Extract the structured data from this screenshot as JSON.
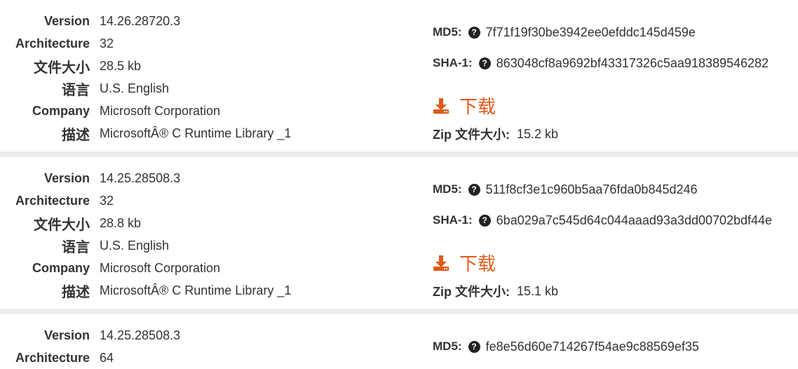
{
  "labels": {
    "version": "Version",
    "architecture": "Architecture",
    "file_size": "文件大小",
    "language": "语言",
    "company": "Company",
    "description": "描述",
    "md5": "MD5:",
    "sha1": "SHA-1:",
    "download": "下载",
    "zip_size": "Zip 文件大小:"
  },
  "icons": {
    "help": "question-circle-icon",
    "download": "download-icon"
  },
  "colors": {
    "accent": "#e05a17",
    "separator": "#eeeeee"
  },
  "entries": [
    {
      "version": "14.26.28720.3",
      "architecture": "32",
      "file_size": "28.5 kb",
      "language": "U.S. English",
      "company": "Microsoft Corporation",
      "description": "MicrosoftÂ® C Runtime Library _1",
      "md5": "7f71f19f30be3942ee0efddc145d459e",
      "sha1": "863048cf8a9692bf43317326c5aa918389546282",
      "zip_size": "15.2 kb"
    },
    {
      "version": "14.25.28508.3",
      "architecture": "32",
      "file_size": "28.8 kb",
      "language": "U.S. English",
      "company": "Microsoft Corporation",
      "description": "MicrosoftÂ® C Runtime Library _1",
      "md5": "511f8cf3e1c960b5aa76fda0b845d246",
      "sha1": "6ba029a7c545d64c044aaad93a3dd00702bdf44e",
      "zip_size": "15.1 kb"
    },
    {
      "version": "14.25.28508.3",
      "architecture": "64",
      "md5": "fe8e56d60e714267f54ae9c88569ef35"
    }
  ]
}
